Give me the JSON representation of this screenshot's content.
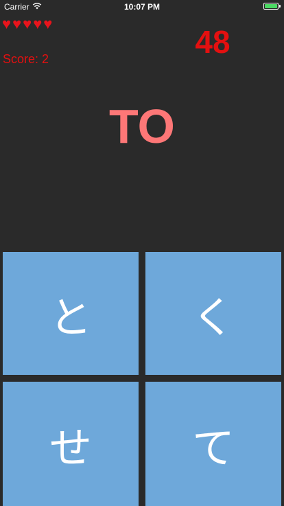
{
  "status_bar": {
    "carrier": "Carrier",
    "time": "10:07 PM",
    "wifi_icon": "wifi-icon",
    "battery_icon": "battery-icon",
    "battery_color": "#4cd964"
  },
  "hud": {
    "lives": [
      "heart-icon",
      "heart-icon",
      "heart-icon",
      "heart-icon",
      "heart-icon"
    ],
    "lives_count": 5,
    "timer": "48",
    "score_label": "Score:",
    "score_value": "2"
  },
  "prompt": {
    "romaji": "TO"
  },
  "answers": [
    {
      "label": "と"
    },
    {
      "label": "く"
    },
    {
      "label": "せ"
    },
    {
      "label": "て"
    }
  ],
  "colors": {
    "background": "#2a2a2a",
    "button": "#6ea8da",
    "prompt": "#fd7777",
    "hud_red": "#e31010"
  }
}
